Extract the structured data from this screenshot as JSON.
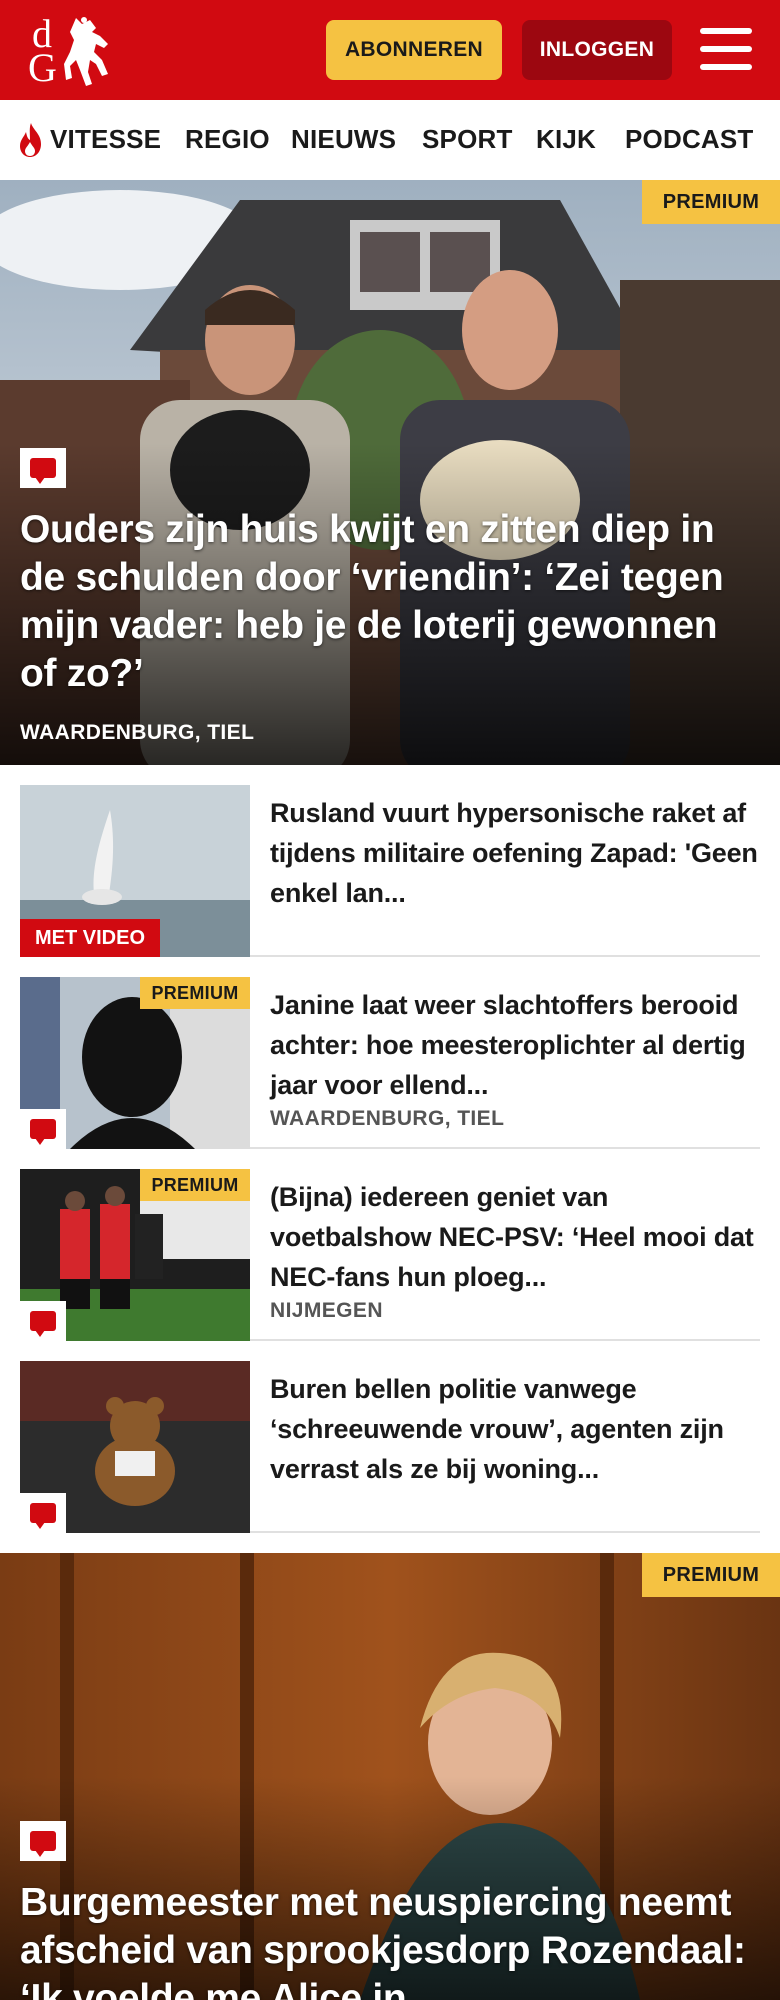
{
  "header": {
    "logo_letters": [
      "d",
      "G"
    ],
    "subscribe_label": "ABONNEREN",
    "login_label": "INLOGGEN"
  },
  "nav": {
    "items": [
      "VITESSE",
      "REGIO",
      "NIEUWS",
      "SPORT",
      "KIJK",
      "PODCAST"
    ]
  },
  "hero1": {
    "badge": "PREMIUM",
    "title": "Ouders zijn huis kwijt en zitten diep in de schulden door ‘vriendin’: ‘Zei tegen mijn vader: heb je de loterij gewonnen of zo?’",
    "location": "WAARDENBURG, TIEL"
  },
  "articles": [
    {
      "title": "Rusland vuurt hypersonische raket af tijdens militaire oefening Zapad: 'Geen enkel lan...",
      "badge": "MET VIDEO",
      "location": ""
    },
    {
      "title": "Janine laat weer slachtoffers berooid achter: hoe meesterop­lichter al dertig jaar voor ellend...",
      "badge": "PREMIUM",
      "location": "WAARDENBURG, TIEL"
    },
    {
      "title": "(Bijna) iedereen geniet van voetbalshow NEC-PSV: ‘Heel mooi dat NEC-fans hun ploeg...",
      "badge": "PREMIUM",
      "location": "NIJMEGEN"
    },
    {
      "title": "Buren bellen politie vanwege ‘schreeuwende vrouw’, agenten zijn verrast als ze bij woning...",
      "badge": "",
      "location": ""
    }
  ],
  "hero2": {
    "badge": "PREMIUM",
    "title": "Burgemeester met neuspiercing neemt afscheid van sprookjesdorp Rozendaal: ‘Ik voelde me Alice in"
  },
  "colors": {
    "brand_red": "#d10a11",
    "dark_red": "#9c0710",
    "premium_yellow": "#f5c242"
  }
}
